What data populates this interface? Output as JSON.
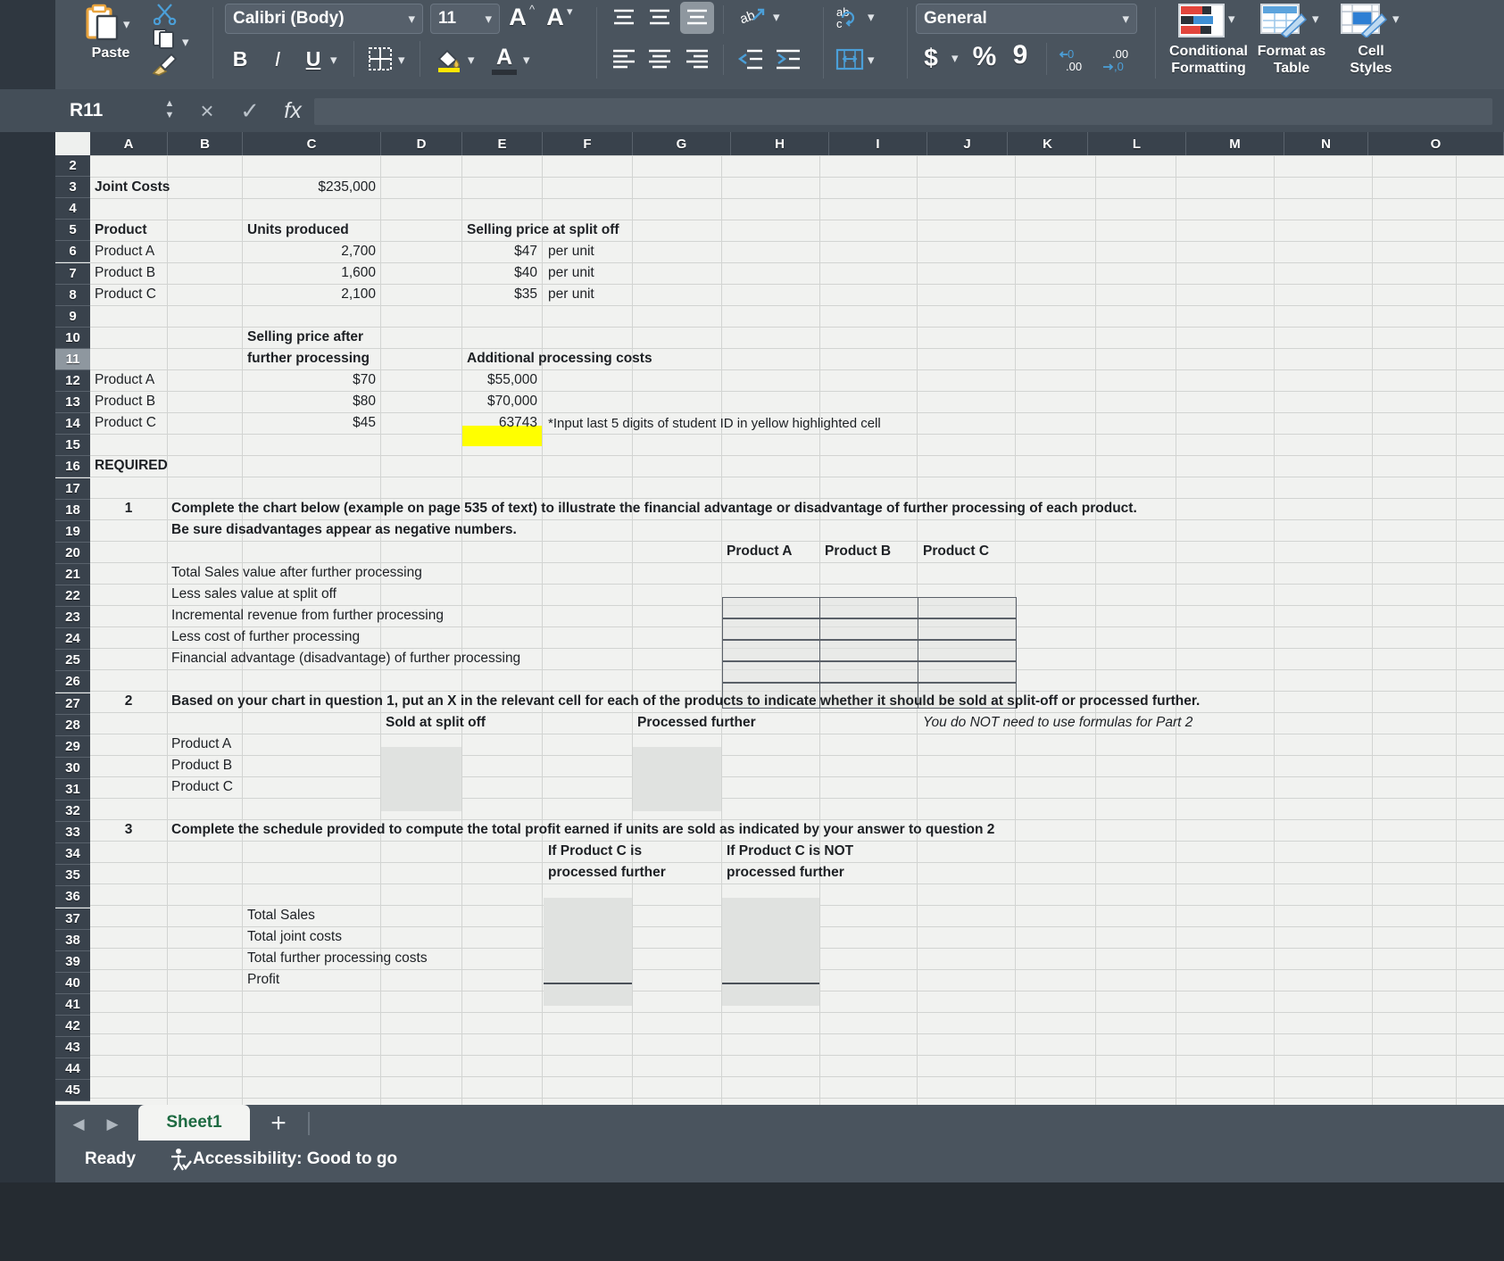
{
  "ribbon": {
    "paste_label": "Paste",
    "font_name": "Calibri (Body)",
    "font_size": "11",
    "grow_font": "A",
    "shrink_font": "A",
    "bold": "B",
    "italic": "I",
    "underline": "U",
    "number_format": "General",
    "currency": "$",
    "percent": "%",
    "comma": "9",
    "conditional_formatting": "Conditional Formatting",
    "format_as_table": "Format as Table",
    "cell_styles": "Cell Styles"
  },
  "formula_bar": {
    "name_box": "R11",
    "cancel": "×",
    "enter": "✓",
    "fx": "fx",
    "formula_value": ""
  },
  "grid": {
    "columns": [
      "A",
      "B",
      "C",
      "D",
      "E",
      "F",
      "G",
      "H",
      "I",
      "J",
      "K",
      "L",
      "M",
      "N",
      "O"
    ],
    "rows": [
      "2",
      "3",
      "4",
      "5",
      "6",
      "7",
      "8",
      "9",
      "10",
      "11",
      "12",
      "13",
      "14",
      "15",
      "16",
      "17",
      "18",
      "19",
      "20",
      "21",
      "22",
      "23",
      "24",
      "25",
      "26",
      "27",
      "28",
      "29",
      "30",
      "31",
      "32",
      "33",
      "34",
      "35",
      "36",
      "37",
      "38",
      "39",
      "40",
      "41",
      "42",
      "43",
      "44",
      "45"
    ],
    "selected_row": "11"
  },
  "cells": {
    "joint_costs_label": "Joint Costs",
    "joint_costs_value": "$235,000",
    "hdr_product": "Product",
    "hdr_units_produced": "Units produced",
    "hdr_selling_price_split": "Selling price at split off",
    "product_a": "Product A",
    "product_b": "Product B",
    "product_c": "Product C",
    "units_a": "2,700",
    "units_b": "1,600",
    "units_c": "2,100",
    "price_a": "$47",
    "price_b": "$40",
    "price_c": "$35",
    "per_unit": "per unit",
    "hdr_sell_after_1": "Selling price after",
    "hdr_sell_after_2": "further processing",
    "hdr_additional_costs": "Additional processing costs",
    "after_a": "$70",
    "after_b": "$80",
    "after_c": "$45",
    "addl_a": "$55,000",
    "addl_b": "$70,000",
    "addl_c": "63743",
    "addl_note": "*Input last 5 digits of student ID in yellow highlighted cell",
    "required": "REQUIRED",
    "q1_num": "1",
    "q1_text": "Complete the chart below (example on page 535 of text) to illustrate the financial advantage or disadvantage of further processing of each product.",
    "q1_text2": "Be sure disadvantages appear as negative numbers.",
    "q1_col_a": "Product A",
    "q1_col_b": "Product B",
    "q1_col_c": "Product C",
    "q1_r21": "Total Sales value after further processing",
    "q1_r22": "Less sales value at split off",
    "q1_r23": "Incremental revenue from further processing",
    "q1_r24": "Less cost of further processing",
    "q1_r25": "Financial advantage (disadvantage) of further processing",
    "q2_num": "2",
    "q2_text": "Based on your chart in question 1, put an X in the relevant cell for each of the products to indicate whether it should be sold at split-off or processed further.",
    "q2_sold_split": "Sold at split off",
    "q2_processed": "Processed further",
    "q2_note": "You do NOT need to use formulas for Part 2",
    "q2_prod_a": "Product A",
    "q2_prod_b": "Product B",
    "q2_prod_c": "Product C",
    "q3_num": "3",
    "q3_text": "Complete the schedule provided to compute the total profit earned if units are sold as indicated by your answer to question 2",
    "q3_hdr1_l1": "If Product C is",
    "q3_hdr1_l2": "processed further",
    "q3_hdr2_l1": "If Product C is NOT",
    "q3_hdr2_l2": "processed further",
    "q3_total_sales": "Total Sales",
    "q3_total_joint": "Total joint costs",
    "q3_total_further": "Total further processing costs",
    "q3_profit": "Profit"
  },
  "tabs": {
    "sheet1": "Sheet1",
    "add": "+",
    "prev": "◀",
    "next": "▶"
  },
  "status": {
    "ready": "Ready",
    "accessibility": "Accessibility: Good to go"
  }
}
